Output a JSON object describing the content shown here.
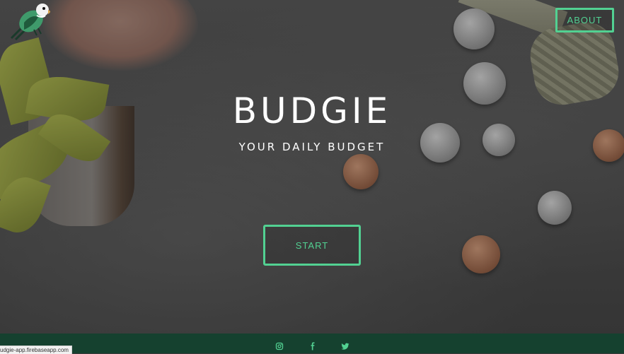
{
  "header": {
    "logo_icon": "budgie-bird-icon",
    "about_label": "ABOUT"
  },
  "hero": {
    "title": "BUDGIE",
    "subtitle": "YOUR DAILY BUDGET",
    "start_label": "START"
  },
  "footer": {
    "social_icons": [
      "instagram-icon",
      "facebook-icon",
      "twitter-icon"
    ]
  },
  "status_bar": {
    "url": "udgie-app.firebaseapp.com"
  },
  "colors": {
    "accent": "#52d192",
    "footer_bg": "#15412f",
    "text": "#ffffff"
  }
}
